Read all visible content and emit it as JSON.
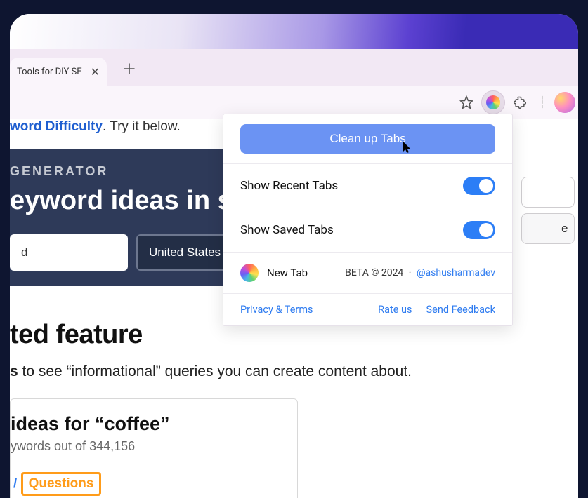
{
  "tab": {
    "title": "Tools for DIY SE",
    "close_glyph": "✕"
  },
  "popup": {
    "clean_up_label": "Clean up Tabs",
    "show_recent_label": "Show Recent Tabs",
    "show_saved_label": "Show Saved Tabs",
    "brand_name": "New Tab",
    "beta": "BETA © 2024",
    "dot": "·",
    "handle": "@ashusharmadev",
    "privacy": "Privacy & Terms",
    "rate": "Rate us",
    "feedback": "Send Feedback",
    "toggles": {
      "recent_on": true,
      "saved_on": true
    }
  },
  "page": {
    "topline_blue": "word Difficulty",
    "topline_rest": ". Try it below.",
    "gen_label": "GENERATOR",
    "headline": "eyword ideas in se",
    "input_frag": "d",
    "country_selected": "United States",
    "right_btn_frag": "e",
    "section_title": "ted feature",
    "body_bold": "s",
    "body_rest": " to see “informational” queries you can create content about.",
    "card_title": "ideas for “coffee”",
    "card_sub_pre": "ywords out of ",
    "card_sub_num": "344,156",
    "questions_prefix": "/ ",
    "questions_label": "Questions"
  }
}
